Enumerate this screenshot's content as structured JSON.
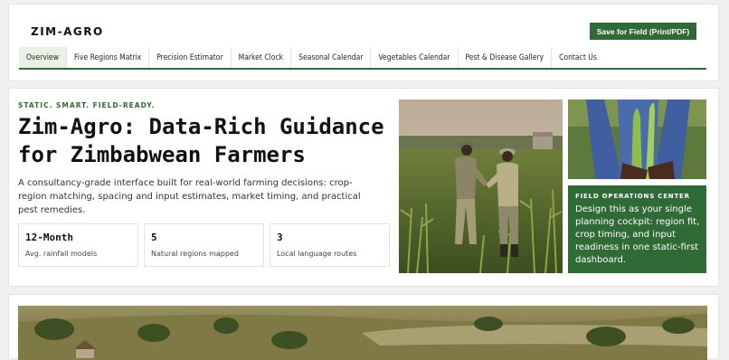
{
  "header": {
    "brand": "ZIM-AGRO",
    "save_label": "Save for Field (Print/PDF)",
    "tabs": [
      {
        "label": "Overview",
        "active": true
      },
      {
        "label": "Five Regions Matrix"
      },
      {
        "label": "Precision Estimator"
      },
      {
        "label": "Market Clock"
      },
      {
        "label": "Seasonal Calendar"
      },
      {
        "label": "Vegetables Calendar"
      },
      {
        "label": "Pest & Disease Gallery"
      },
      {
        "label": "Contact Us"
      }
    ]
  },
  "hero": {
    "kicker": "STATIC. SMART. FIELD-READY.",
    "title": "Zim-Agro: Data-Rich Guidance for Zimbabwean Farmers",
    "description": "A consultancy-grade interface built for real-world farming decisions: crop-region matching, spacing and input estimates, market timing, and practical pest remedies.",
    "stats": [
      {
        "value": "12-Month",
        "label": "Avg. rainfall models"
      },
      {
        "value": "5",
        "label": "Natural regions mapped"
      },
      {
        "value": "3",
        "label": "Local language routes"
      }
    ],
    "ops": {
      "title": "FIELD OPERATIONS CENTER",
      "text": "Design this as your single planning cockpit: region fit, crop timing, and input readiness in one static-first dashboard."
    }
  },
  "colors": {
    "accent": "#2f6a37",
    "active_tab_bg": "#e8f1e4",
    "page_bg": "#eef1ee"
  }
}
